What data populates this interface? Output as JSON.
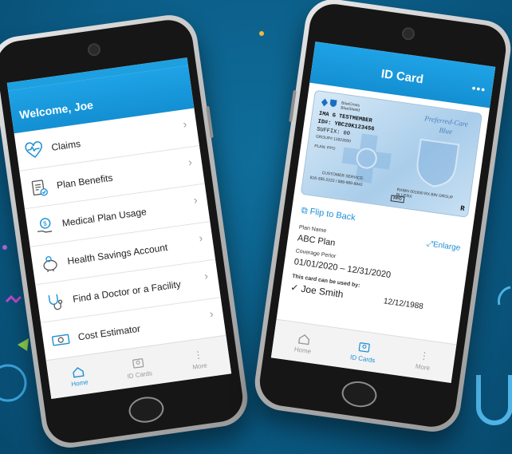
{
  "colors": {
    "brand": "#1a8fd6",
    "header": "#1ea0e0",
    "background": "#0b5c86"
  },
  "left_phone": {
    "welcome": "Welcome, Joe",
    "menu": [
      {
        "label": "Claims",
        "icon": "heartbeat-icon"
      },
      {
        "label": "Plan Benefits",
        "icon": "checklist-icon"
      },
      {
        "label": "Medical Plan Usage",
        "icon": "dollar-hand-icon"
      },
      {
        "label": "Health Savings Account",
        "icon": "piggy-bank-icon"
      },
      {
        "label": "Find a Doctor or a Facility",
        "icon": "stethoscope-icon"
      },
      {
        "label": "Cost Estimator",
        "icon": "money-icon"
      }
    ],
    "tabs": [
      {
        "label": "Home",
        "icon": "home-icon",
        "active": true
      },
      {
        "label": "ID Cards",
        "icon": "id-card-icon",
        "active": false
      },
      {
        "label": "More",
        "icon": "more-icon",
        "active": false
      }
    ]
  },
  "right_phone": {
    "title": "ID Card",
    "card": {
      "name_line": "IMA G TESTMEMBER",
      "id_line": "ID#: YBC20K123456",
      "suffix_line": "SUFFIX: 00",
      "group_line": "GROUP# 11823000",
      "plan_line": "PLAN: PPO",
      "customer_service": "CUSTOMER SERVICE:",
      "phone_line": "816-395-2222 / 888-989-8842",
      "brand_text": "BlueCross BlueShield",
      "preferred": "Preferred-Care",
      "blue": "Blue",
      "ppo": "PPO",
      "rx": "R",
      "rxbin": "RXBIN 001930   RX BIN   GROUP BLUERX"
    },
    "flip_label": "Flip to Back",
    "enlarge_label": "Enlarge",
    "plan_name_label": "Plan Name",
    "plan_name": "ABC Plan",
    "coverage_label": "Coverage Perior",
    "coverage": "01/01/2020 – 12/31/2020",
    "used_by_label": "This card can be used by:",
    "member_name": "✓ Joe Smith",
    "member_dob": "12/12/1988",
    "tabs": [
      {
        "label": "Home",
        "icon": "home-icon",
        "active": false
      },
      {
        "label": "ID Cards",
        "icon": "id-card-icon",
        "active": true
      },
      {
        "label": "More",
        "icon": "more-icon",
        "active": false
      }
    ]
  }
}
